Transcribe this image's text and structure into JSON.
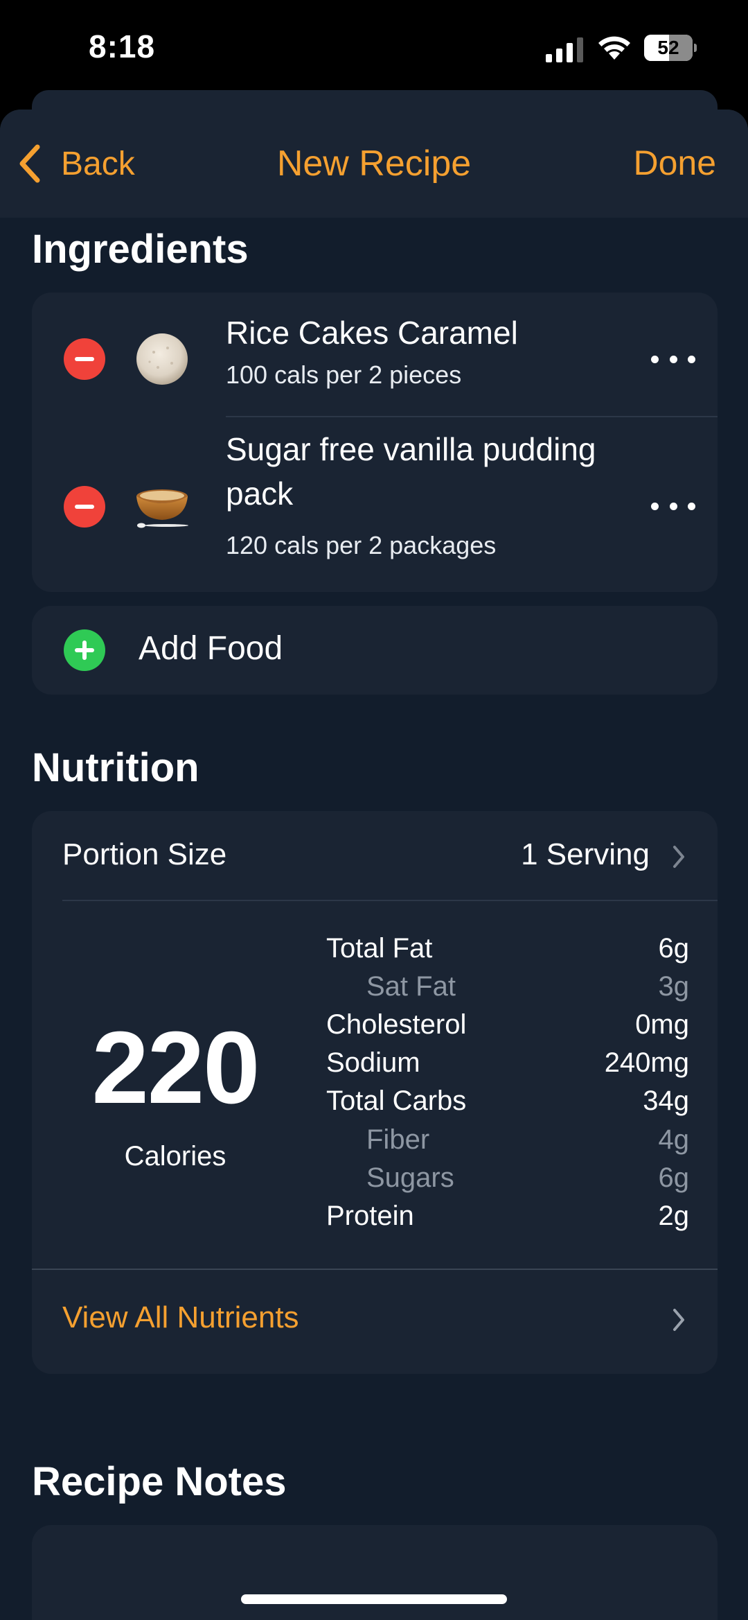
{
  "status_bar": {
    "time": "8:18",
    "battery": "52",
    "battery_level": 0.52
  },
  "nav": {
    "back_label": "Back",
    "title": "New Recipe",
    "done_label": "Done"
  },
  "ingredients": {
    "title": "Ingredients",
    "items": [
      {
        "name": "Rice Cakes Caramel",
        "detail": "100 cals per 2 pieces",
        "icon": "rice-cake-image"
      },
      {
        "name": "Sugar free vanilla pudding pack",
        "detail": "120 cals per 2 packages",
        "icon": "pudding-bowl-image"
      }
    ],
    "add_label": "Add Food"
  },
  "nutrition": {
    "title": "Nutrition",
    "portion_label": "Portion Size",
    "portion_value": "1 Serving",
    "calories": "220",
    "calories_label": "Calories",
    "nutrients": [
      {
        "label": "Total Fat",
        "value": "6g",
        "sub": false
      },
      {
        "label": "Sat Fat",
        "value": "3g",
        "sub": true
      },
      {
        "label": "Cholesterol",
        "value": "0mg",
        "sub": false
      },
      {
        "label": "Sodium",
        "value": "240mg",
        "sub": false
      },
      {
        "label": "Total Carbs",
        "value": "34g",
        "sub": false
      },
      {
        "label": "Fiber",
        "value": "4g",
        "sub": true
      },
      {
        "label": "Sugars",
        "value": "6g",
        "sub": true
      },
      {
        "label": "Protein",
        "value": "2g",
        "sub": false
      }
    ],
    "view_all_label": "View All Nutrients"
  },
  "notes": {
    "title": "Recipe Notes"
  },
  "colors": {
    "accent": "#f5a030",
    "background": "#121d2c",
    "card": "#1a2433",
    "delete": "#f0423a",
    "add": "#2fca55"
  }
}
